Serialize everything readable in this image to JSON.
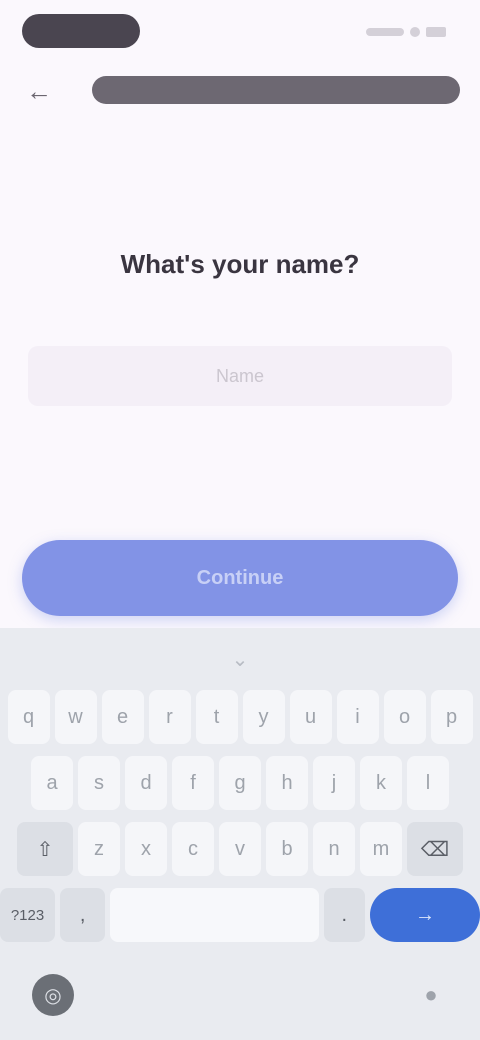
{
  "status_bar": {
    "time": ""
  },
  "app_bar": {
    "back_icon": "arrow-back-icon",
    "title": ""
  },
  "heading": "What's your name?",
  "name_field": {
    "value": "",
    "placeholder": "Name"
  },
  "primary_button": {
    "label": "Continue"
  },
  "keyboard": {
    "row1": [
      "q",
      "w",
      "e",
      "r",
      "t",
      "y",
      "u",
      "i",
      "o",
      "p"
    ],
    "row2": [
      "a",
      "s",
      "d",
      "f",
      "g",
      "h",
      "j",
      "k",
      "l"
    ],
    "row3": [
      "z",
      "x",
      "c",
      "v",
      "b",
      "n",
      "m"
    ],
    "shift_icon": "shift-icon",
    "backspace_icon": "backspace-icon",
    "symbols_label": "?123",
    "comma_label": ",",
    "space_label": "",
    "period_label": ".",
    "enter_icon": "enter-icon",
    "globe_icon": "globe-icon",
    "mic_icon": "microphone-icon",
    "collapse_icon": "chevron-down-icon"
  },
  "colors": {
    "primary_button": "#8293e6",
    "enter_key": "#3e6fd8",
    "background": "#fbf8fd"
  }
}
